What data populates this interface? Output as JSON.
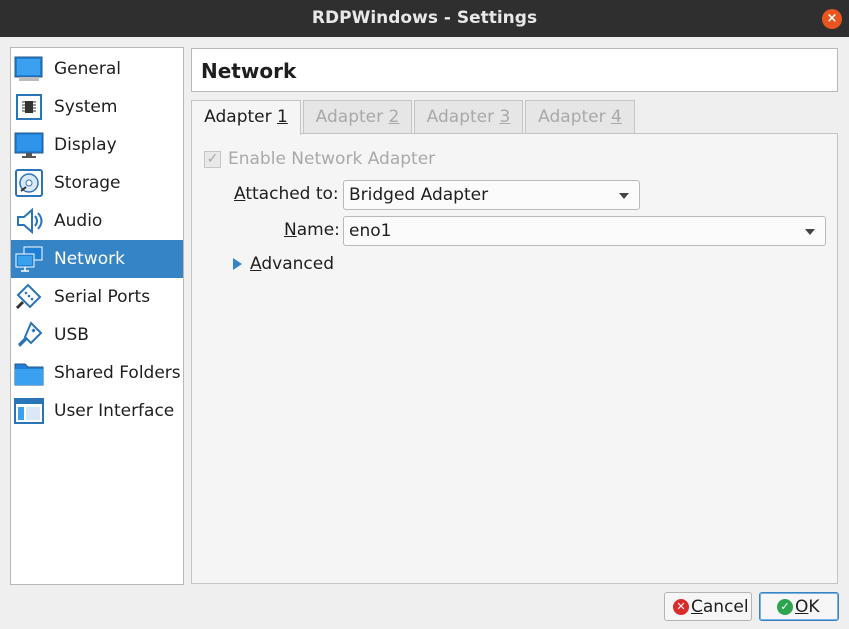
{
  "window": {
    "title": "RDPWindows - Settings",
    "close_glyph": "×"
  },
  "sidebar": {
    "items": [
      {
        "label": "General",
        "icon": "general-icon"
      },
      {
        "label": "System",
        "icon": "system-chip-icon"
      },
      {
        "label": "Display",
        "icon": "display-monitor-icon"
      },
      {
        "label": "Storage",
        "icon": "storage-disc-icon"
      },
      {
        "label": "Audio",
        "icon": "audio-speaker-icon"
      },
      {
        "label": "Network",
        "icon": "network-icon",
        "selected": true
      },
      {
        "label": "Serial Ports",
        "icon": "serial-port-icon"
      },
      {
        "label": "USB",
        "icon": "usb-icon"
      },
      {
        "label": "Shared Folders",
        "icon": "shared-folder-icon"
      },
      {
        "label": "User Interface",
        "icon": "user-interface-icon"
      }
    ]
  },
  "page": {
    "title": "Network"
  },
  "tabs": [
    {
      "label": "Adapter ",
      "mnemonic": "1",
      "active": true
    },
    {
      "label": "Adapter ",
      "mnemonic": "2",
      "active": false
    },
    {
      "label": "Adapter ",
      "mnemonic": "3",
      "active": false
    },
    {
      "label": "Adapter ",
      "mnemonic": "4",
      "active": false
    }
  ],
  "adapter": {
    "enable_label": "Enable Network Adapter",
    "enabled": true,
    "check_glyph": "✓",
    "attached_label_mnemonic": "A",
    "attached_label_rest": "ttached to:",
    "attached_value": "Bridged Adapter",
    "name_label_mnemonic": "N",
    "name_label_rest": "ame:",
    "name_value": "eno1",
    "advanced_mnemonic": "A",
    "advanced_rest": "dvanced"
  },
  "buttons": {
    "cancel_mnemonic": "C",
    "cancel_rest": "ancel",
    "ok_mnemonic": "O",
    "ok_rest": "K",
    "cancel_glyph": "✕",
    "ok_glyph": "✓"
  },
  "colors": {
    "accent": "#3584c5",
    "titlebar": "#2f2f2f",
    "close": "#e9541f",
    "cancel_icon": "#d92c2c",
    "ok_icon": "#2da44e"
  }
}
